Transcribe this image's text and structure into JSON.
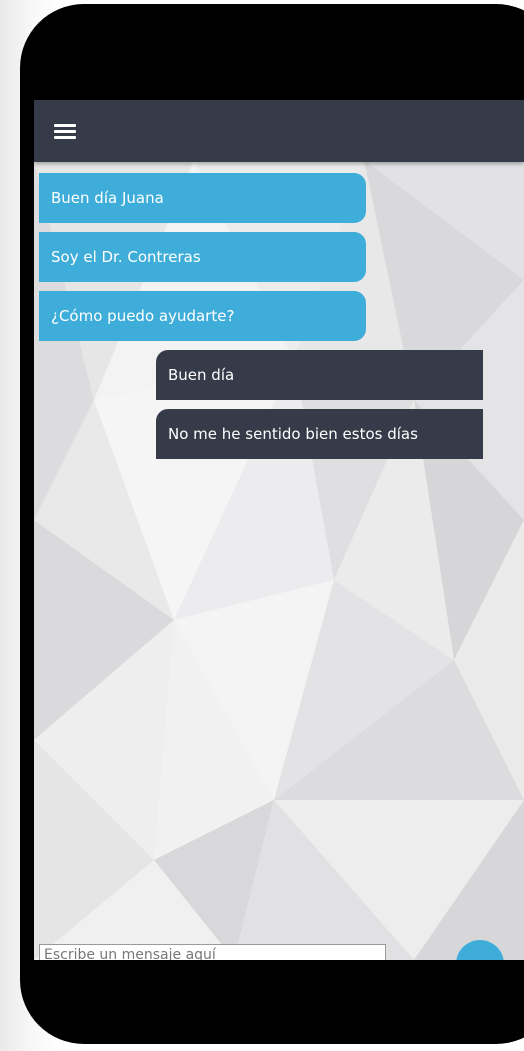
{
  "appbar": {
    "menu_icon": "hamburger-menu-icon",
    "color": "#353b48"
  },
  "messages": [
    {
      "from": "doctor",
      "text": "Buen día Juana"
    },
    {
      "from": "doctor",
      "text": "Soy el Dr. Contreras"
    },
    {
      "from": "doctor",
      "text": "¿Cómo puedo ayudarte?"
    },
    {
      "from": "patient",
      "text": "Buen día"
    },
    {
      "from": "patient",
      "text": "No me he sentido bien estos días"
    }
  ],
  "composer": {
    "placeholder": "Escribe un mensaje aquí",
    "send_icon": "send-icon"
  },
  "colors": {
    "incoming_bubble": "#3fadd9",
    "outgoing_bubble": "#363b49",
    "phone_frame": "#000000"
  }
}
